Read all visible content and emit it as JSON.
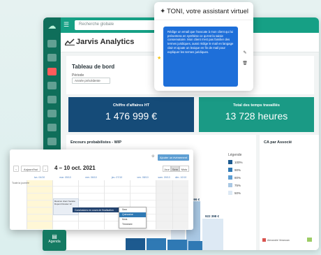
{
  "search": {
    "placeholder": "Recherche globale"
  },
  "brand": {
    "title": "Jarvis Analytics"
  },
  "dashboard": {
    "title": "Tableau de bord",
    "period_label": "Période",
    "period_value": "Année précédente"
  },
  "kpis": [
    {
      "label": "Chiffre d'affaires HT",
      "value": "1 476 999 €"
    },
    {
      "label": "Total des temps travaillés",
      "value": "13 728 heures"
    }
  ],
  "wip": {
    "title": "Encours probabilistes - WIP",
    "legend_title": "Légende",
    "legend": [
      {
        "label": "100%",
        "color": "#1d5a8f"
      },
      {
        "label": "90%",
        "color": "#2f79b4"
      },
      {
        "label": "80%",
        "color": "#5f9fd3"
      },
      {
        "label": "75%",
        "color": "#a9c8e4"
      },
      {
        "label": "50%",
        "color": "#dde9f4"
      }
    ],
    "value_labels": [
      "596 €",
      "922 398 €"
    ]
  },
  "ca_card": {
    "title": "CA par Associé",
    "legend": "Alexandre Veranoan"
  },
  "assistant": {
    "title": "TONI, votre assistant virtuel",
    "message": "Rédige un email que l'avocate à mon client qui lui présentera en synthèse ce qu'est la saisie conservatoire. Mon client n'est pas familier des termes juridiques, aussi rédige le mail en langage clair et ajoute un lexique en fin de mail pour expliquer les termes juridiques."
  },
  "calendar": {
    "add_button": "Ajouter un événement",
    "prev": "Aujourd'hui",
    "range": "4 – 10 oct. 2021",
    "views": [
      "Jour",
      "Sem",
      "Mois"
    ],
    "days": [
      "lun. 04/10",
      "mar. 05/10",
      "mer. 06/10",
      "jeu. 07/10",
      "ven. 08/10",
      "sam. 09/10",
      "dim. 10/10"
    ],
    "row_label": "Toute la journée",
    "event_text": "Réunion client Société Dupont Dossier 12",
    "drag_text": "Conclusions en cours de finalisation",
    "menu": [
      "Sem",
      "Quinzaine",
      "Mois",
      "Trimestre"
    ]
  },
  "tab": {
    "label": "Agenda"
  }
}
